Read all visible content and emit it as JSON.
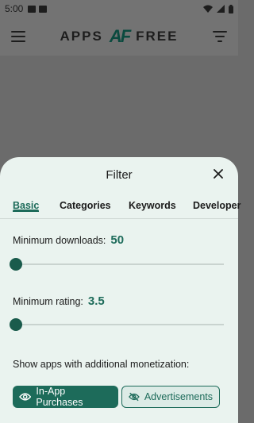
{
  "status_bar": {
    "time": "5:00"
  },
  "app_bar": {
    "logo_left": "APPS",
    "logo_mark": "AF",
    "logo_right": "FREE"
  },
  "filter_sheet": {
    "title": "Filter",
    "close_label": "✕",
    "tabs": [
      {
        "label": "Basic",
        "active": true
      },
      {
        "label": "Categories",
        "active": false
      },
      {
        "label": "Keywords",
        "active": false
      },
      {
        "label": "Developer",
        "active": false
      }
    ],
    "min_downloads": {
      "label": "Minimum downloads:",
      "value": "50",
      "slider_fraction": 0.0
    },
    "min_rating": {
      "label": "Minimum rating:",
      "value": "3.5",
      "slider_fraction": 0.0
    },
    "monetization": {
      "label": "Show apps with additional monetization:",
      "in_app_purchases": {
        "label": "In-App Purchases",
        "selected": true,
        "icon": "eye-icon"
      },
      "advertisements": {
        "label": "Advertisements",
        "selected": false,
        "icon": "eye-off-icon"
      }
    }
  },
  "colors": {
    "accent": "#1d6b5a",
    "sheet_bg": "#eaf3ef",
    "scrim": "#6b6b6b"
  }
}
